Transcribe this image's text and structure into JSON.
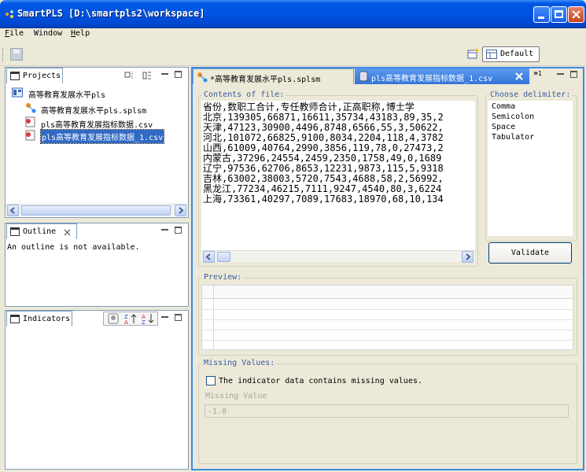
{
  "window": {
    "title": "SmartPLS [D:\\smartpls2\\workspace]"
  },
  "menu": {
    "items": [
      {
        "accel": "F",
        "rest": "ile"
      },
      {
        "accel": "",
        "rest": "Window"
      },
      {
        "accel": "H",
        "rest": "elp"
      }
    ]
  },
  "perspective": {
    "label": "Default"
  },
  "projects": {
    "tab_label": "Projects",
    "items": [
      "高等教育发展水平pls",
      "高等教育发展水平pls.splsm",
      "pls高等教育发展指标数据.csv",
      "pls高等教育发展指标数据_1.csv"
    ]
  },
  "outline": {
    "tab_label": "Outline",
    "message": "An outline is not available."
  },
  "indicators": {
    "tab_label": "Indicators"
  },
  "editor": {
    "tabs": [
      "*高等教育发展水平pls.splsm",
      "pls高等教育发展指标数据_1.csv"
    ],
    "overflow_count": "1",
    "contents_label": "Contents of file:",
    "lines": [
      "省份,数职工合计,专任教师合计,正高职称,博士学",
      "北京,139305,66871,16611,35734,43183,89,35,2",
      "天津,47123,30900,4496,8748,6566,55,3,50622,",
      "河北,101072,66825,9100,8034,2204,118,4,3782",
      "山西,61009,40764,2990,3856,119,78,0,27473,2",
      "内蒙古,37296,24554,2459,2350,1758,49,0,1689",
      "辽宁,97536,62706,8653,12231,9873,115,5,9318",
      "吉林,63002,38003,5720,7543,4688,58,2,56992,",
      "黑龙江,77234,46215,7111,9247,4540,80,3,6224",
      "上海,73361,40297,7089,17683,18970,68,10,134"
    ],
    "delimiter_label": "Choose delimiter:",
    "delimiters": [
      "Comma",
      "Semicolon",
      "Space",
      "Tabulator"
    ],
    "validate_label": "Validate",
    "preview_label": "Preview:",
    "missing_label": "Missing Values:",
    "missing_checkbox_label": "The indicator data contains missing values.",
    "missing_value_label": "Missing Value",
    "missing_value": "-1.0"
  }
}
